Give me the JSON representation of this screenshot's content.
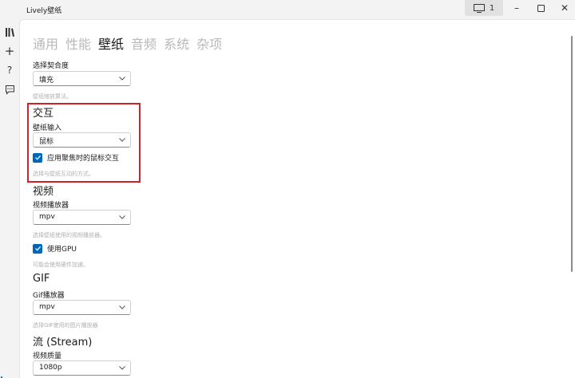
{
  "app": {
    "title": "Lively壁纸",
    "monitor_label": "1"
  },
  "tabs": [
    {
      "label": "通用",
      "active": false
    },
    {
      "label": "性能",
      "active": false
    },
    {
      "label": "壁纸",
      "active": true
    },
    {
      "label": "音频",
      "active": false
    },
    {
      "label": "系统",
      "active": false
    },
    {
      "label": "杂项",
      "active": false
    }
  ],
  "fit": {
    "label": "选择契合度",
    "value": "填充",
    "hint": "壁纸缩放算法。"
  },
  "interaction": {
    "title": "交互",
    "input_label": "壁纸输入",
    "input_value": "鼠标",
    "checkbox_label": "应用聚焦时的鼠标交互",
    "checkbox_checked": true,
    "hint": "选择与壁纸互动的方式。"
  },
  "video": {
    "title": "视频",
    "player_label": "视频播放器",
    "player_value": "mpv",
    "player_hint": "选择壁纸使用的视频播放器。",
    "gpu_label": "使用GPU",
    "gpu_checked": true,
    "gpu_hint": "可能会使用硬件加速。"
  },
  "gif": {
    "title": "GIF",
    "player_label": "Gif播放器",
    "player_value": "mpv",
    "player_hint": "选择GIF使用的图片播放器"
  },
  "stream": {
    "title": "流 (Stream)",
    "quality_label": "视频质量",
    "quality_value": "1080p"
  },
  "colors": {
    "accent": "#0067c0",
    "highlight": "#d0202a"
  }
}
